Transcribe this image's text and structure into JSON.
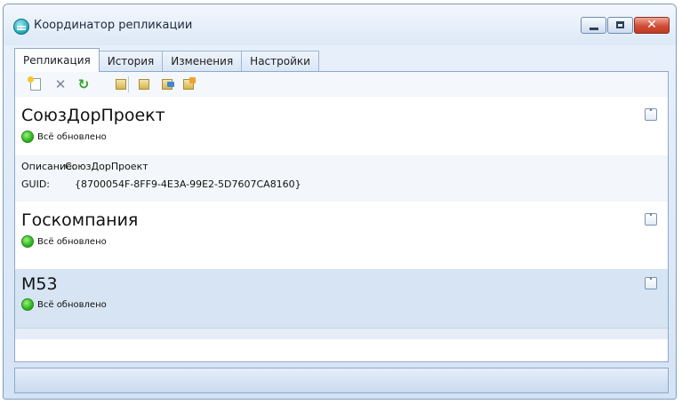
{
  "window": {
    "title": "Координатор репликации",
    "close_glyph": "✕"
  },
  "tabs": [
    {
      "label": "Репликация",
      "active": true
    },
    {
      "label": "История",
      "active": false
    },
    {
      "label": "Изменения",
      "active": false
    },
    {
      "label": "Настройки",
      "active": false
    }
  ],
  "toolbar": {
    "icons": [
      "new-icon",
      "delete-icon",
      "refresh-icon",
      "move-left-icon",
      "move-right-icon",
      "transfer-icon",
      "export-icon"
    ],
    "delete_glyph": "✕",
    "refresh_glyph": "↻"
  },
  "groups": [
    {
      "name": "СоюзДорПроект",
      "status": "Всё обновлено",
      "expanded": true,
      "chevron": "˄",
      "details": {
        "description_label": "Описание:",
        "description_value": "СоюзДорПроект",
        "guid_label": "GUID:",
        "guid_value": "{8700054F-8FF9-4E3A-99E2-5D7607CA8160}"
      }
    },
    {
      "name": "Госкомпания",
      "status": "Всё обновлено",
      "expanded": false,
      "chevron": "˅"
    },
    {
      "name": "М53",
      "status": "Всё обновлено",
      "expanded": false,
      "chevron": "˅",
      "selected": true
    }
  ],
  "colors": {
    "status_ok": "#2fb61f",
    "selected_row": "#d7e4f3",
    "close_button": "#d04d35"
  }
}
